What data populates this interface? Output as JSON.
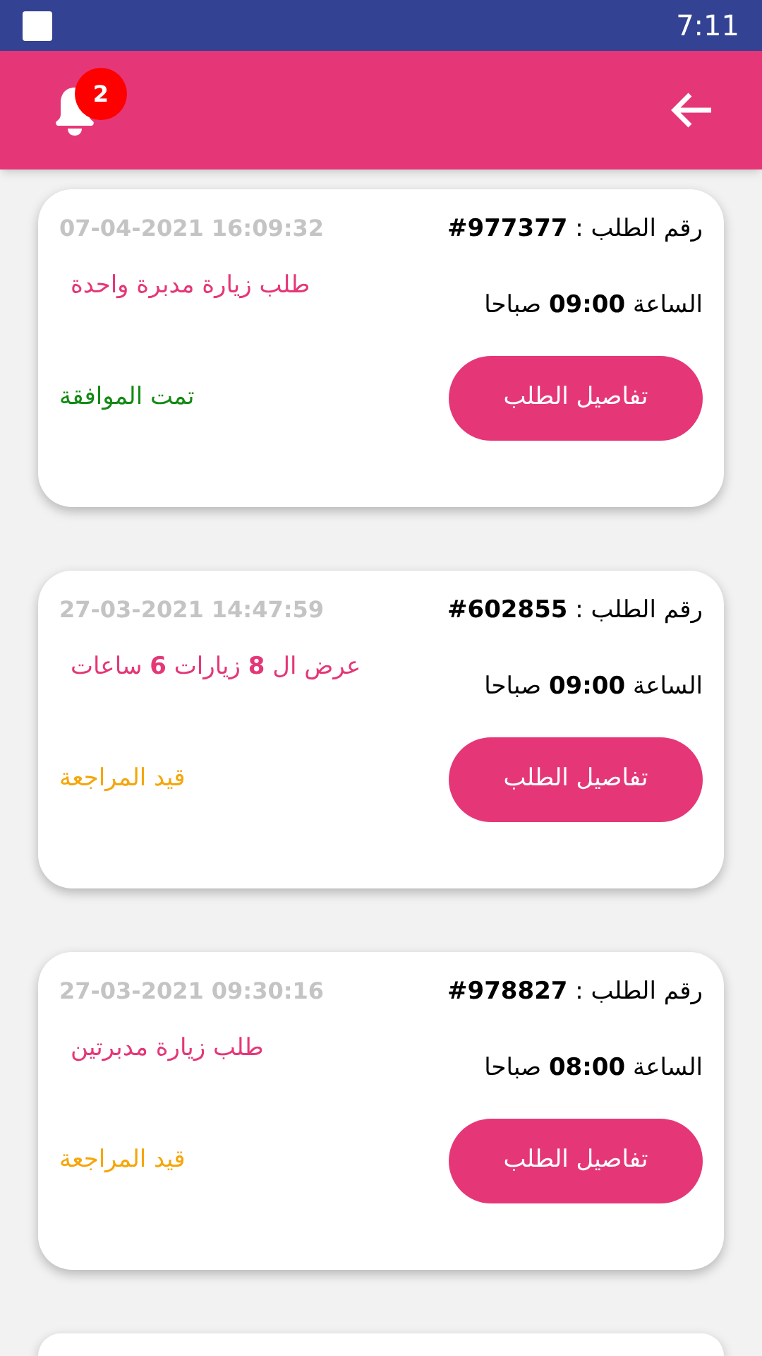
{
  "status_bar": {
    "time": "7:11"
  },
  "header": {
    "notification_count": "2"
  },
  "orders": [
    {
      "number": "رقم الطلب : **#977377**",
      "datetime": "07-04-2021 16:09:32",
      "description": "طلب زيارة مدبرة واحدة",
      "time": "الساعة **09:00** صباحا",
      "button": "تفاصيل الطلب",
      "status": "تمت الموافقة",
      "color": "#138a13"
    },
    {
      "number": "رقم الطلب : **#602855**",
      "datetime": "27-03-2021 14:47:59",
      "description": "عرض ال **8** زيارات **6** ساعات",
      "time": "الساعة **09:00** صباحا",
      "button": "تفاصيل الطلب",
      "status": "قيد المراجعة",
      "color": "#f5a60a"
    },
    {
      "number": "رقم الطلب : **#978827**",
      "datetime": "27-03-2021 09:30:16",
      "description": "طلب زيارة مدبرتين",
      "time": "الساعة **08:00** صباحا",
      "button": "تفاصيل الطلب",
      "status": "قيد المراجعة",
      "color": "#f5a60a"
    }
  ]
}
